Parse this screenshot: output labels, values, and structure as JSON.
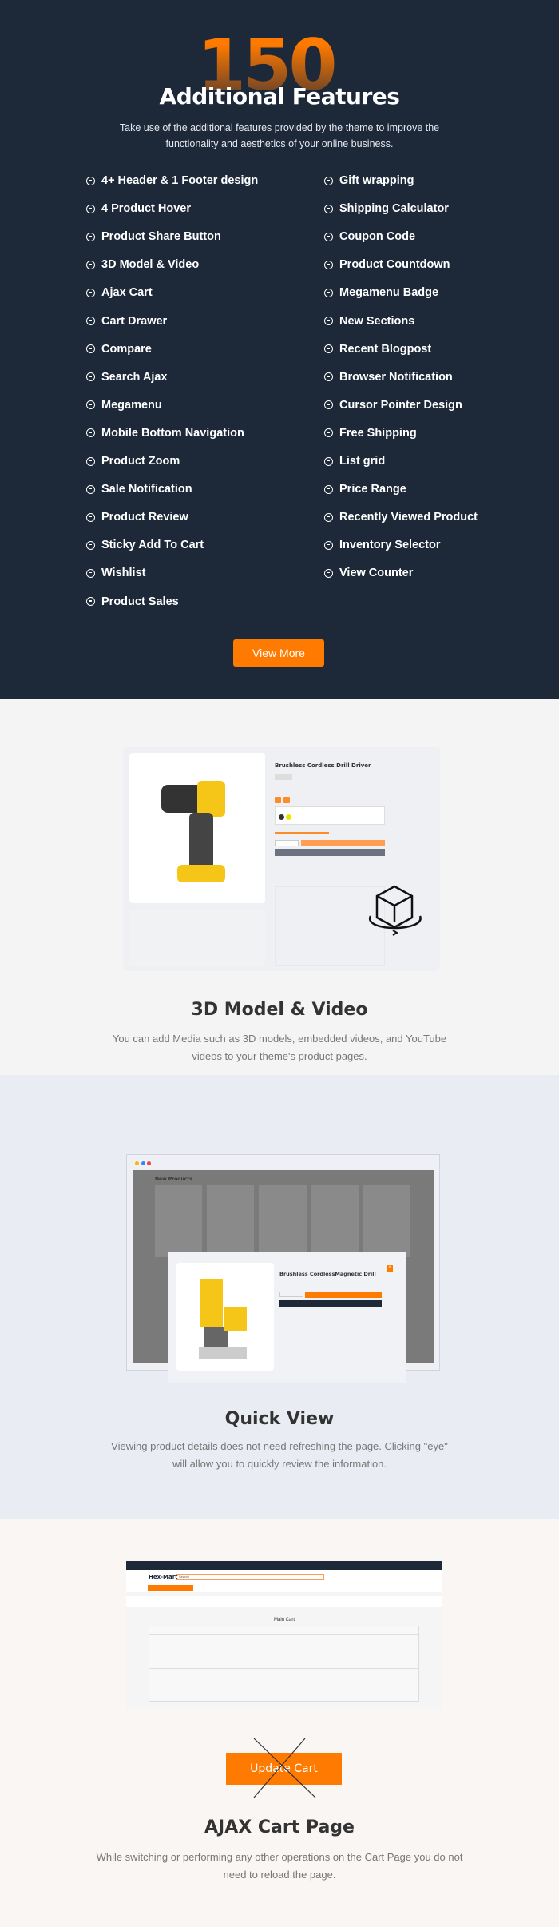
{
  "hero": {
    "big_number": "150",
    "plus": "+",
    "title": "Additional Features",
    "subtitle": "Take use of the additional features provided by the theme to improve the functionality and aesthetics of your online business.",
    "accent": "#ff7a00",
    "background": "#1d2839"
  },
  "features_left": [
    "4+ Header & 1 Footer design",
    "4 Product Hover",
    "Product Share Button",
    "3D Model & Video",
    "Ajax Cart",
    "Cart Drawer",
    "Compare",
    "Search Ajax",
    "Megamenu",
    "Mobile Bottom Navigation",
    "Product Zoom",
    "Sale Notification",
    "Product Review",
    "Sticky Add To Cart",
    "Wishlist",
    "Product Sales"
  ],
  "features_right": [
    "Gift wrapping",
    "Shipping Calculator",
    "Coupon Code",
    "Product Countdown",
    "Megamenu Badge",
    "New Sections",
    "Recent Blogpost",
    "Browser Notification",
    "Cursor Pointer Design",
    "Free Shipping",
    "List grid",
    "Price Range",
    "Recently Viewed Product",
    "Inventory Selector",
    "View Counter"
  ],
  "view_more": "View More",
  "model": {
    "title": "3D Model & Video",
    "desc": "You can add Media such as 3D models, embedded videos, and YouTube videos to your theme's product pages.",
    "product_name": "Brushless Cordless Drill Driver",
    "icon": "3d-cube-rotate-icon"
  },
  "quickview": {
    "title": "Quick View",
    "desc": "Viewing product details does not need refreshing the page. Clicking \"eye\" will allow you to quickly review the information.",
    "section": "New Products",
    "product_name": "Brushless CordlessMagnetic Drill"
  },
  "cart": {
    "title": "AJAX Cart Page",
    "desc": "While switching or performing any other operations on the Cart Page you do not need to reload the page.",
    "brand": "Hex-Mart",
    "search_placeholder": "Search",
    "heading": "Main Cart",
    "update_button": "Update Cart"
  }
}
